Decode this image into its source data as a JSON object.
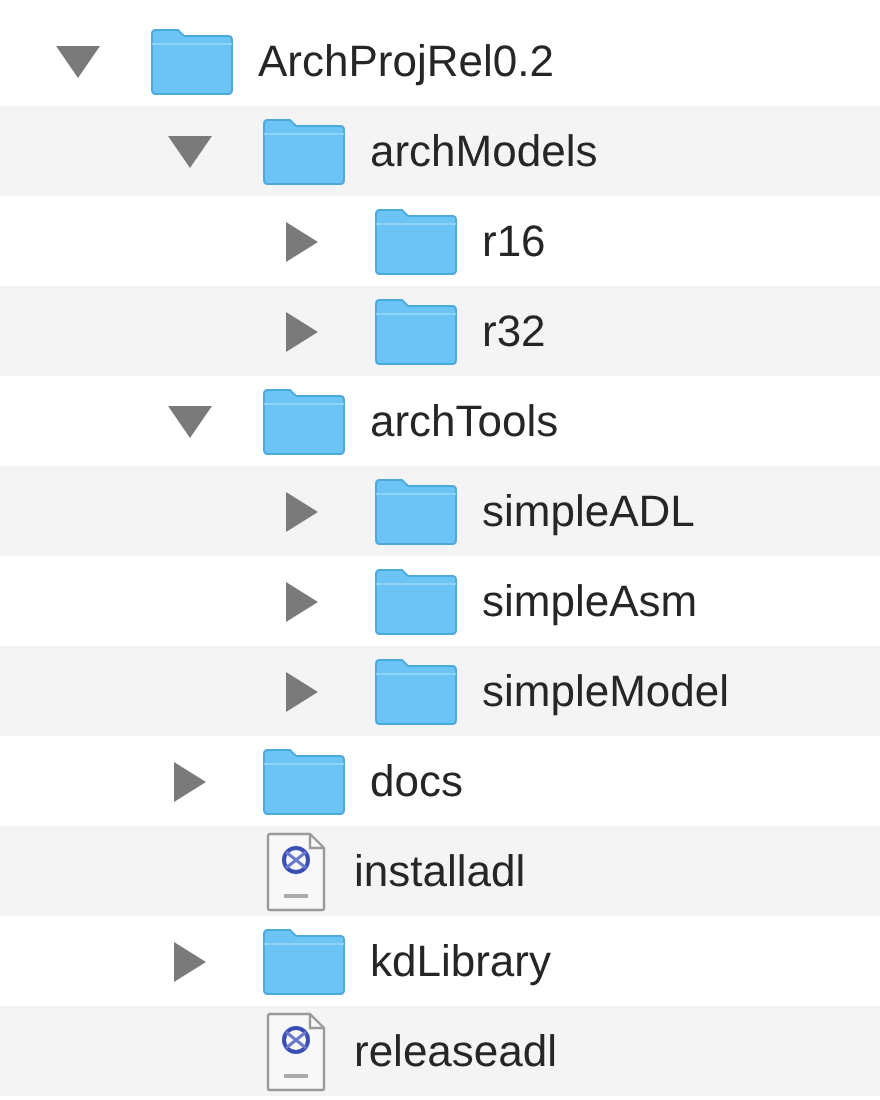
{
  "tree": [
    {
      "name": "ArchProjRel0.2",
      "kind": "folder",
      "expanded": true,
      "children": [
        {
          "name": "archModels",
          "kind": "folder",
          "expanded": true,
          "children": [
            {
              "name": "r16",
              "kind": "folder",
              "expanded": false
            },
            {
              "name": "r32",
              "kind": "folder",
              "expanded": false
            }
          ]
        },
        {
          "name": "archTools",
          "kind": "folder",
          "expanded": true,
          "children": [
            {
              "name": "simpleADL",
              "kind": "folder",
              "expanded": false
            },
            {
              "name": "simpleAsm",
              "kind": "folder",
              "expanded": false
            },
            {
              "name": "simpleModel",
              "kind": "folder",
              "expanded": false
            }
          ]
        },
        {
          "name": "docs",
          "kind": "folder",
          "expanded": false
        },
        {
          "name": "installadl",
          "kind": "file"
        },
        {
          "name": "kdLibrary",
          "kind": "folder",
          "expanded": false
        },
        {
          "name": "releaseadl",
          "kind": "file"
        }
      ]
    }
  ]
}
